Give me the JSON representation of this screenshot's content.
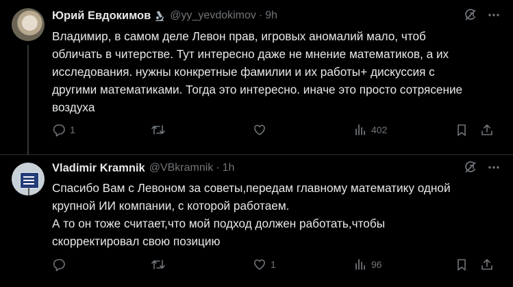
{
  "tweets": [
    {
      "author": "Юрий Евдокимов",
      "handle": "@yy_yevdokimov",
      "separator": "·",
      "time": "9h",
      "text": "Владимир, в самом деле Левон прав, игровых аномалий мало, чтоб\nобличать в читерстве. Тут интересно даже не мнение математиков, а их\nисследования. нужны конкретные фамилии и их работы+ дискуссия с\nдругими математиками. Тогда это интересно. иначе это просто сотрясение\nвоздуха",
      "replies": "1",
      "retweets": "",
      "likes": "",
      "views": "402"
    },
    {
      "author": "Vladimir Kramnik",
      "handle": "@VBkramnik",
      "separator": "·",
      "time": "1h",
      "text": "Спасибо Вам с Левоном за советы,передам главному математику одной\nкрупной ИИ компании, с которой работаем.\nА то он тоже считает,что мой подход должен работать,чтобы\nскорректировал свою позицию",
      "replies": "",
      "retweets": "",
      "likes": "1",
      "views": "96"
    }
  ],
  "icons": {
    "badge": "microscope-icon",
    "grok": "grok-icon",
    "more": "more-icon",
    "reply": "reply-icon",
    "retweet": "retweet-icon",
    "like": "heart-icon",
    "views": "views-icon",
    "bookmark": "bookmark-icon",
    "share": "share-icon"
  },
  "colors": {
    "background": "#000000",
    "text": "#e7e9ea",
    "muted": "#71767b",
    "divider": "#2f3336"
  }
}
